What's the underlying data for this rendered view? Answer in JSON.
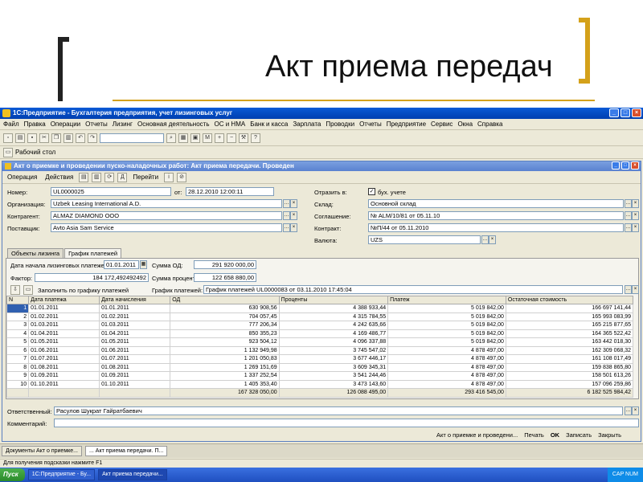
{
  "slide": {
    "title": "Акт приема передач"
  },
  "app": {
    "title": "1С:Предприятие - Бухгалтерия предприятия, учет лизинговых услуг",
    "menu": [
      "Файл",
      "Правка",
      "Операции",
      "Отчеты",
      "Лизинг",
      "Основная деятельность",
      "ОС и НМА",
      "Банк и касса",
      "Зарплата",
      "Проводки",
      "Отчеты",
      "Предприятие",
      "Сервис",
      "Окна",
      "Справка"
    ],
    "desktop_label": "Рабочий стол"
  },
  "doc": {
    "title": "Акт о приемке и проведении пуско-наладочных работ: Акт приема передачи. Проведен",
    "toolbar": {
      "operation": "Операция",
      "actions": "Действия",
      "goto": "Перейти"
    },
    "fields": {
      "number_label": "Номер:",
      "number": "UL0000025",
      "from_label": "от:",
      "from": "28.12.2010 12:00:11",
      "org_label": "Организация:",
      "org": "Uzbek Leasing International A.D.",
      "contractor_label": "Контрагент:",
      "contractor": "ALMAZ DIAMOND ООО",
      "supplier_label": "Поставщик:",
      "supplier": "Avto Asia Sam Service",
      "reflect_label": "Отразить в:",
      "reflect": "бух. учете",
      "warehouse_label": "Склад:",
      "warehouse": "Основной склад",
      "agreement_label": "Соглашение:",
      "agreement": "№ ALM/10/81 от 05.11.10",
      "contract_label": "Контракт:",
      "contract": "№П/44 от 05.11.2010",
      "currency_label": "Валюта:",
      "currency": "UZS"
    },
    "tabs": [
      "Объекты лизинга",
      "График платежей"
    ],
    "schedule": {
      "start_label": "Дата начала лизинговых платежей:",
      "start": "01.01.2011",
      "od_label": "Сумма ОД:",
      "od": "291 920 000,00",
      "factor_label": "Фактор:",
      "factor": "184 172,492492492",
      "interest_label": "Сумма процентов:",
      "interest": "122 658 880,00",
      "fill_label": "Заполнить по графику платежей",
      "plan_label": "График платежей:",
      "plan": "График платежей UL0000083 от 03.11.2010 17:45:04"
    },
    "table": {
      "headers": [
        "N",
        "Дата платежа",
        "Дата начисления",
        "ОД",
        "Проценты",
        "Платеж",
        "Остаточная стоимость"
      ],
      "rows": [
        [
          "1",
          "01.01.2011",
          "01.01.2011",
          "630 908,56",
          "4 388 933,44",
          "5 019 842,00",
          "166 697 141,44"
        ],
        [
          "2",
          "01.02.2011",
          "01.02.2011",
          "704 057,45",
          "4 315 784,55",
          "5 019 842,00",
          "165 993 083,99"
        ],
        [
          "3",
          "01.03.2011",
          "01.03.2011",
          "777 206,34",
          "4 242 635,66",
          "5 019 842,00",
          "165 215 877,65"
        ],
        [
          "4",
          "01.04.2011",
          "01.04.2011",
          "850 355,23",
          "4 169 486,77",
          "5 019 842,00",
          "164 365 522,42"
        ],
        [
          "5",
          "01.05.2011",
          "01.05.2011",
          "923 504,12",
          "4 096 337,88",
          "5 019 842,00",
          "163 442 018,30"
        ],
        [
          "6",
          "01.06.2011",
          "01.06.2011",
          "1 132 949,98",
          "3 745 547,02",
          "4 878 497,00",
          "162 309 068,32"
        ],
        [
          "7",
          "01.07.2011",
          "01.07.2011",
          "1 201 050,83",
          "3 677 446,17",
          "4 878 497,00",
          "161 108 017,49"
        ],
        [
          "8",
          "01.08.2011",
          "01.08.2011",
          "1 269 151,69",
          "3 609 345,31",
          "4 878 497,00",
          "159 838 865,80"
        ],
        [
          "9",
          "01.09.2011",
          "01.09.2011",
          "1 337 252,54",
          "3 541 244,46",
          "4 878 497,00",
          "158 501 613,26"
        ],
        [
          "10",
          "01.10.2011",
          "01.10.2011",
          "1 405 353,40",
          "3 473 143,60",
          "4 878 497,00",
          "157 096 259,86"
        ]
      ],
      "totals": [
        "",
        "",
        "",
        "167 328 050,00",
        "126 088 495,00",
        "293 416 545,00",
        "6 182 525 984,42"
      ]
    },
    "responsible_label": "Ответственный:",
    "responsible": "Расулов Шукрат Гайратбаевич",
    "comment_label": "Комментарий:",
    "footer": {
      "act": "Акт о приемке и проведени...",
      "print": "Печать",
      "ok": "OK",
      "save": "Записать",
      "close": "Закрыть"
    }
  },
  "windows_bar": [
    "Документы Акт о приемке...",
    "... Акт приема передачи. П..."
  ],
  "status": "Для получения подсказки нажмите F1",
  "taskbar": {
    "start": "Пуск",
    "app": "1С:Предприятие - Бу...",
    "doc": "Акт приема передачи...",
    "tray": "CAP  NUM"
  }
}
